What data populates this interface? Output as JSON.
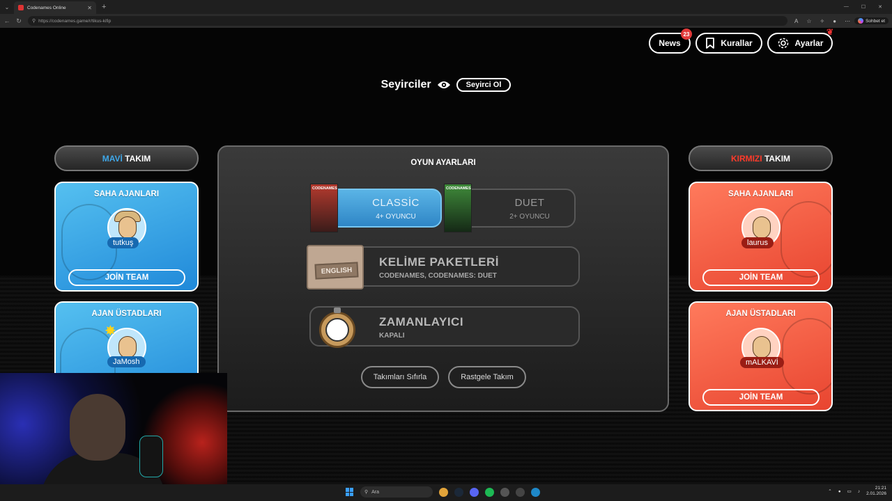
{
  "browser": {
    "tab_title": "Codenames Online",
    "url": "https://codenames.game/r/tikus-kifip",
    "copilot_label": "Sohbet et"
  },
  "header": {
    "news_label": "News",
    "news_badge": "23",
    "rules_label": "Kurallar",
    "settings_label": "Ayarlar"
  },
  "spectators": {
    "label": "Seyirciler",
    "become_label": "Seyirci Ol"
  },
  "blue_team": {
    "header_accent": "MAVİ",
    "header_rest": "TAKIM",
    "operatives_title": "SAHA AJANLARI",
    "operative_name": "tutkuş",
    "join_label": "JOİN TEAM",
    "spymasters_title": "AJAN ÜSTADLARI",
    "spymaster_name": "JaMosh"
  },
  "red_team": {
    "header_accent": "KIRMIZI",
    "header_rest": "TAKIM",
    "operatives_title": "SAHA AJANLARI",
    "operative_name": "laurus",
    "join_label": "JOİN TEAM",
    "spymasters_title": "AJAN ÜSTADLARI",
    "spymaster_name": "mALKAVİ",
    "spymaster_join_label": "JOİN TEAM"
  },
  "game_settings": {
    "title": "OYUN AYARLARI",
    "modes": [
      {
        "name": "CLASSİC",
        "players": "4+ OYUNCU",
        "box_label": "CODENAMES",
        "active": true
      },
      {
        "name": "DUET",
        "players": "2+ OYUNCU",
        "box_label": "CODENAMES",
        "active": false
      }
    ],
    "word_packs_title": "KELİME PAKETLERİ",
    "word_packs_value": "CODENAMES, CODENAMES: DUET",
    "word_pack_card": "ENGLISH",
    "timer_title": "ZAMANLAYICI",
    "timer_value": "KAPALI",
    "reset_teams_label": "Takımları Sıfırla",
    "random_team_label": "Rastgele Takım"
  },
  "taskbar": {
    "search_placeholder": "Ara",
    "time": "21:21",
    "date": "2.01.2026"
  },
  "colors": {
    "blue_accent": "#3fa7e8",
    "red_accent": "#ff3a2a",
    "badge_red": "#e23a3a"
  }
}
